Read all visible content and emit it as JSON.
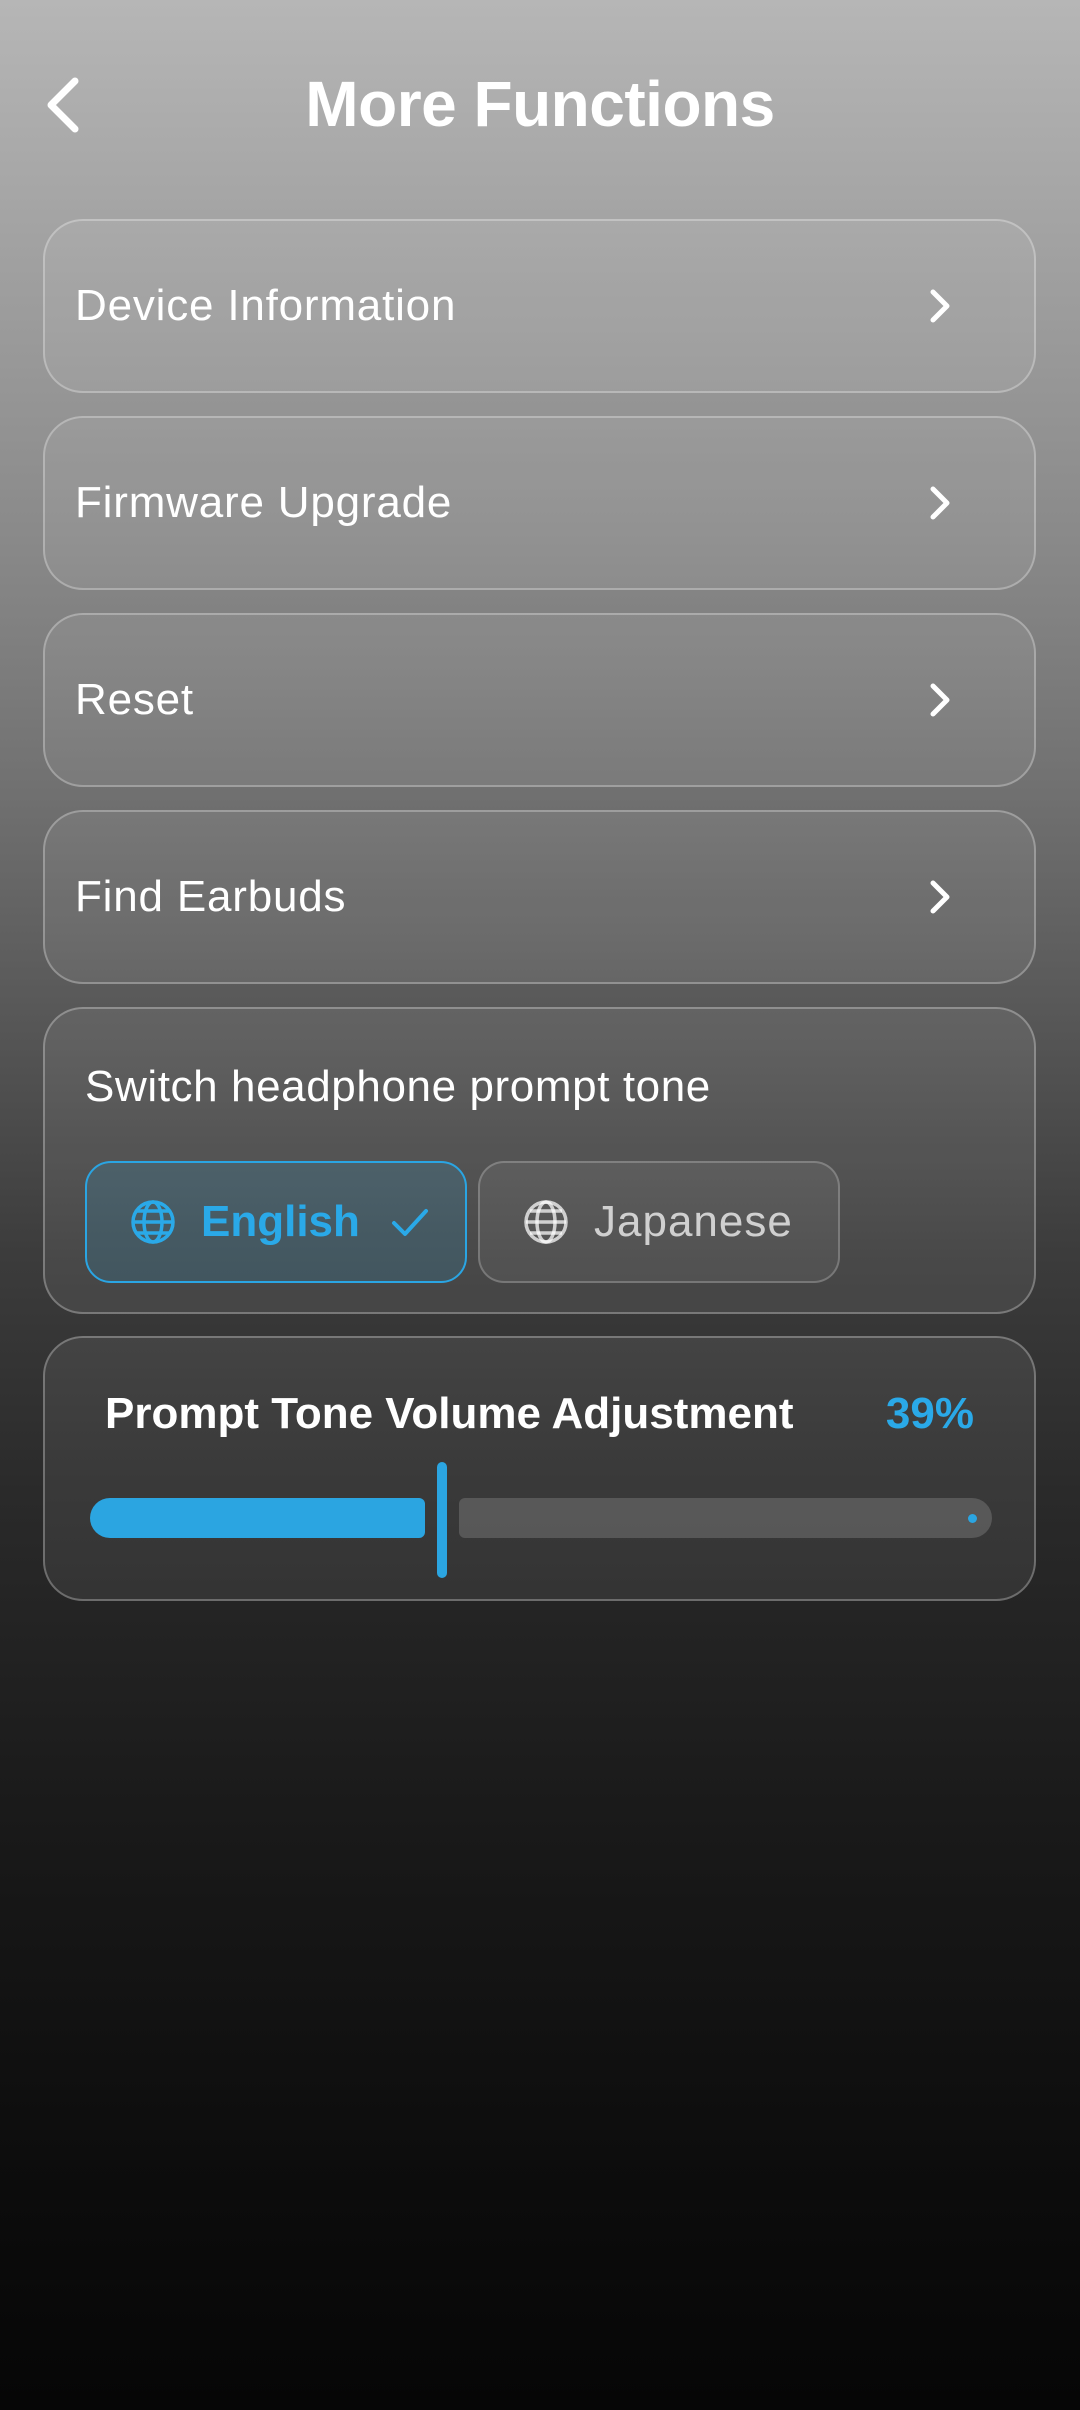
{
  "header": {
    "title": "More Functions"
  },
  "menu_items": [
    {
      "label": "Device Information"
    },
    {
      "label": "Firmware Upgrade"
    },
    {
      "label": "Reset"
    },
    {
      "label": "Find Earbuds"
    }
  ],
  "prompt_tone": {
    "title": "Switch headphone prompt tone",
    "options": [
      {
        "label": "English",
        "selected": true
      },
      {
        "label": "Japanese",
        "selected": false
      }
    ]
  },
  "volume": {
    "title": "Prompt Tone Volume Adjustment",
    "value_label": "39%",
    "value_percent": 39
  },
  "colors": {
    "accent": "#2aa9e8"
  },
  "icons": {
    "back": "chevron-left-icon",
    "row": "chevron-right-icon",
    "language": "globe-icon",
    "selected": "check-icon"
  }
}
